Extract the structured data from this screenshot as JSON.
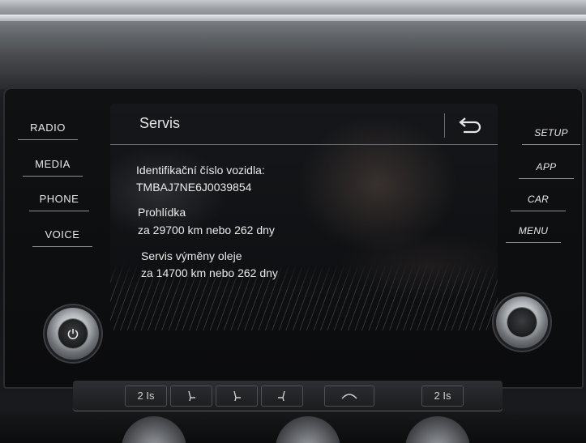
{
  "left_menu": {
    "radio": "RADIO",
    "media": "MEDIA",
    "phone": "PHONE",
    "voice": "VOICE"
  },
  "right_menu": {
    "setup": "SETUP",
    "app": "APP",
    "car": "CAR",
    "menu": "MENU"
  },
  "screen": {
    "title": "Servis",
    "back_icon": "back-arrow-icon",
    "vin_label": "Identifikační číslo vozidla:",
    "vin_value": "TMBAJ7NE6J0039854",
    "inspection_label": "Prohlídka",
    "inspection_value": "za 29700 km nebo 262 dny",
    "oil_label": "Servis výměny oleje",
    "oil_value": "za 14700 km nebo 262 dny"
  },
  "climate": {
    "left_temp": "2 Is",
    "right_temp": "2 Is"
  },
  "colors": {
    "text": "#ebebeb",
    "divider": "#6b6e72",
    "screen_bg": "#0d0e10"
  }
}
